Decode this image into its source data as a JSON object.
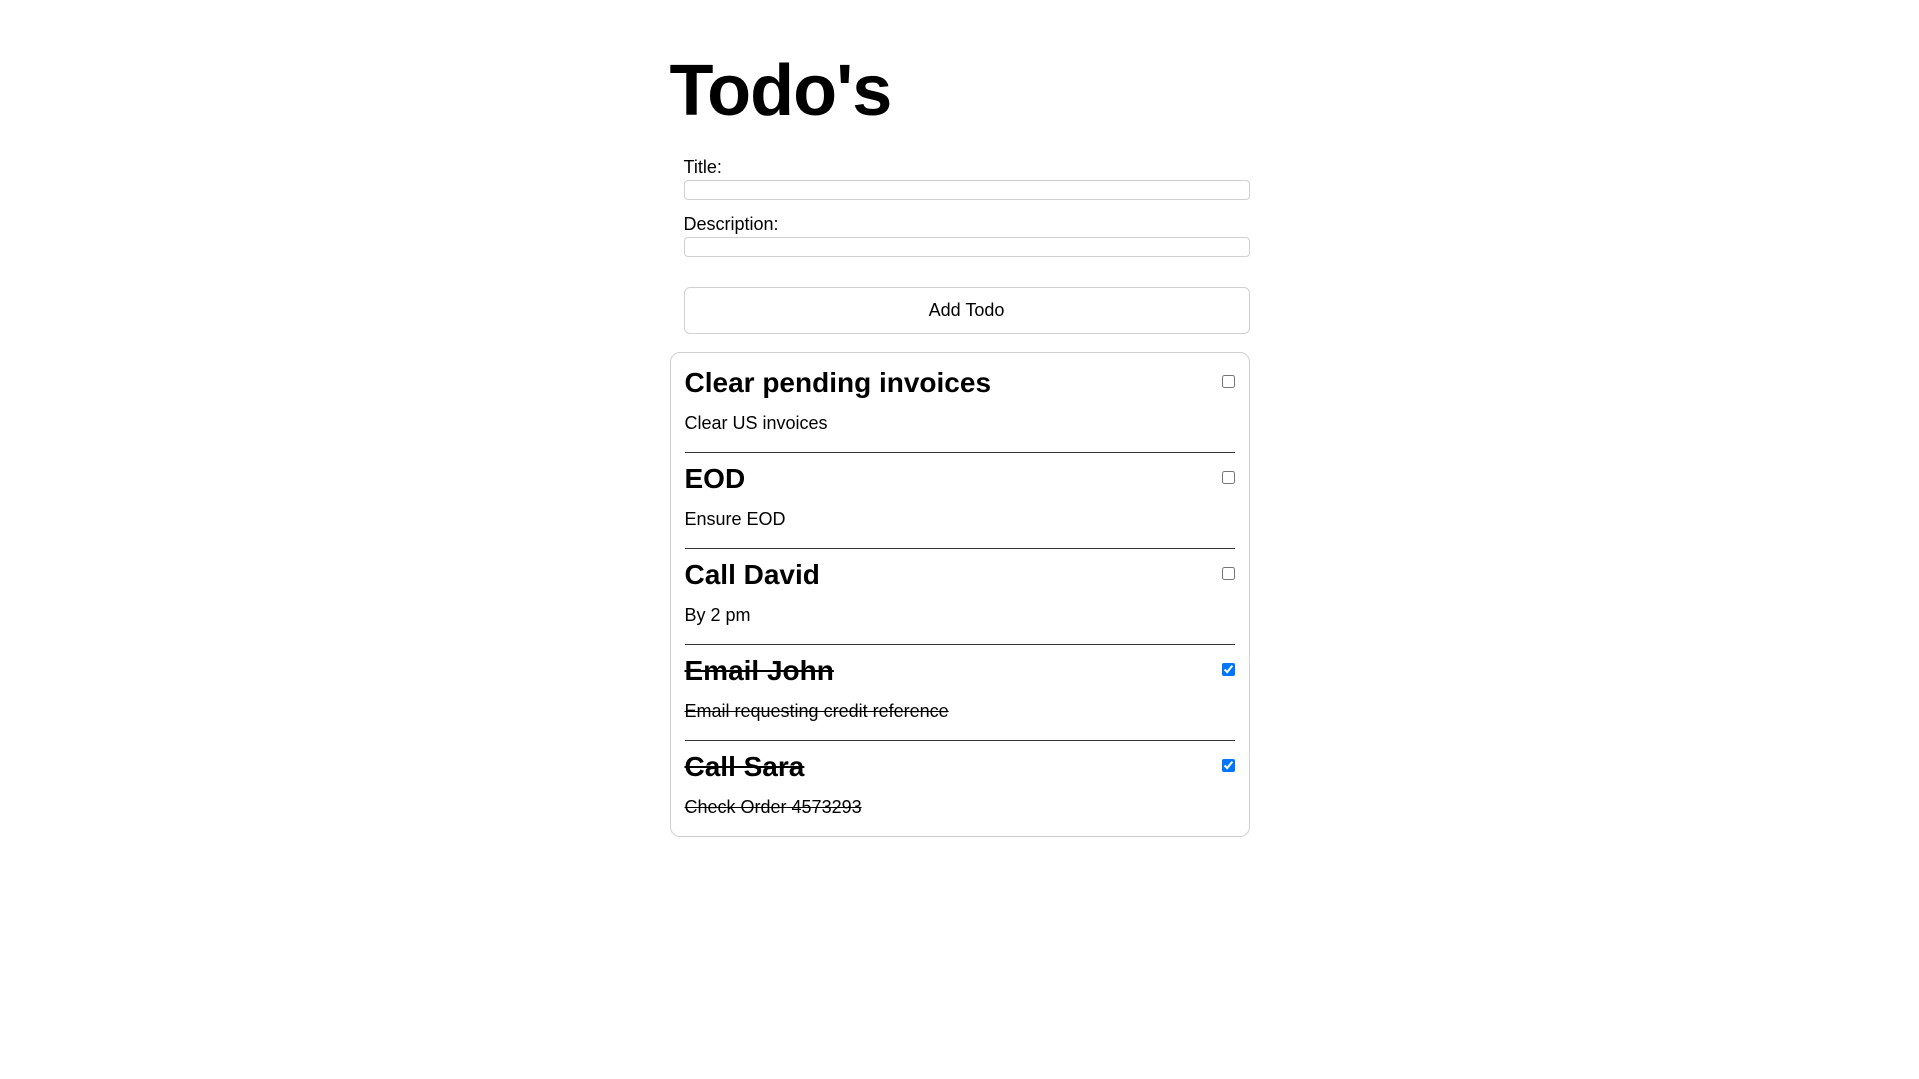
{
  "header": {
    "title": "Todo's"
  },
  "form": {
    "titleLabel": "Title:",
    "descriptionLabel": "Description:",
    "titleValue": "",
    "descriptionValue": "",
    "addButtonLabel": "Add Todo"
  },
  "todos": [
    {
      "title": "Clear pending invoices",
      "description": "Clear US invoices",
      "completed": false
    },
    {
      "title": "EOD",
      "description": "Ensure EOD",
      "completed": false
    },
    {
      "title": "Call David",
      "description": "By 2 pm",
      "completed": false
    },
    {
      "title": "Email John",
      "description": "Email requesting credit reference",
      "completed": true
    },
    {
      "title": "Call Sara",
      "description": "Check Order 4573293",
      "completed": true
    }
  ]
}
